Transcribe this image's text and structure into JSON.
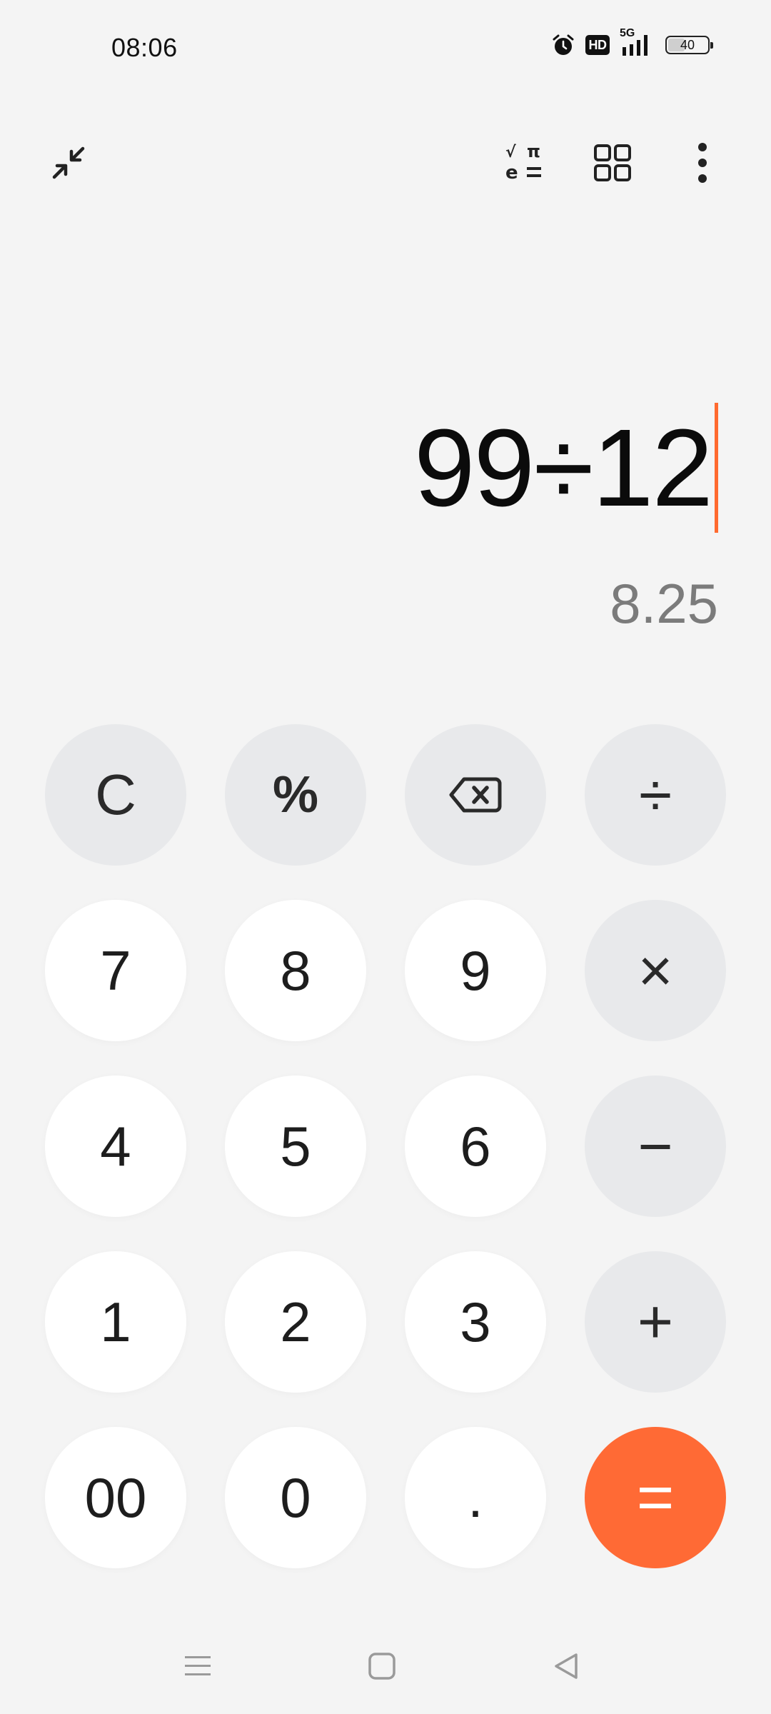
{
  "status_bar": {
    "time": "08:06",
    "network": "5G",
    "hd_label": "HD",
    "battery": "40",
    "icons": [
      "alarm-icon",
      "hd-icon",
      "signal-5g-icon",
      "battery-icon"
    ]
  },
  "toolbar": {
    "icons": [
      "collapse-icon",
      "scientific-mode-icon",
      "grid-icon",
      "more-options-icon"
    ]
  },
  "display": {
    "expression": "99÷12",
    "result": "8.25"
  },
  "keypad": {
    "clear": "C",
    "percent": "%",
    "divide": "÷",
    "seven": "7",
    "eight": "8",
    "nine": "9",
    "multiply": "×",
    "four": "4",
    "five": "5",
    "six": "6",
    "minus": "−",
    "one": "1",
    "two": "2",
    "three": "3",
    "plus": "+",
    "double_zero": "00",
    "zero": "0",
    "decimal": ".",
    "equals": "="
  },
  "colors": {
    "accent": "#ff6a35",
    "cursor": "#ff6a2f",
    "operator_bg": "#e8e9eb",
    "digit_bg": "#ffffff",
    "background": "#f4f4f4",
    "result_text": "#7b7b7b"
  },
  "nav_bar": {
    "icons": [
      "menu-icon",
      "home-icon",
      "back-icon"
    ]
  }
}
